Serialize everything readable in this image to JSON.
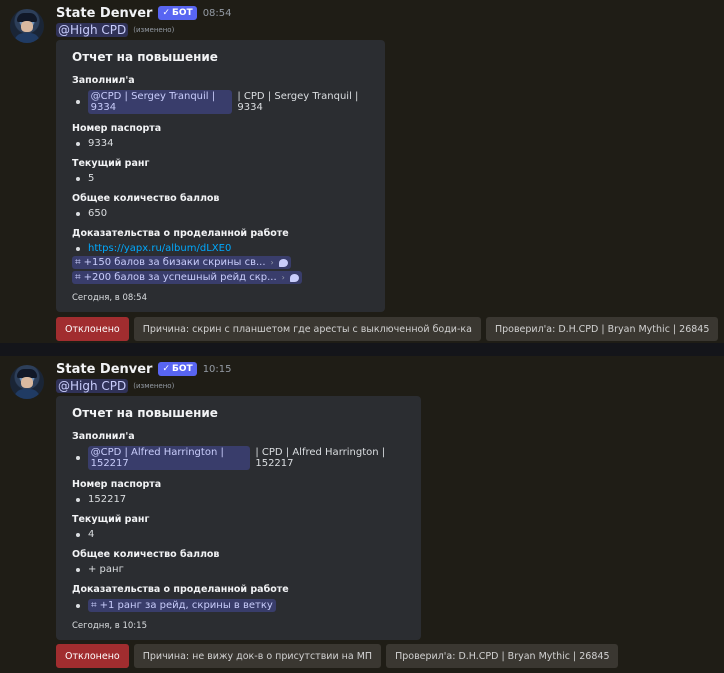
{
  "messages": [
    {
      "author": "State Denver",
      "bot_badge": "БОТ",
      "time": "08:54",
      "mention": "@High CPD",
      "edited": "(изменено)",
      "embed": {
        "title": "Отчет на повышение",
        "fields": {
          "filled_by": {
            "name": "Заполнил'а",
            "mention": "@CPD | Sergey Tranquil | 9334",
            "text": "| CPD | Sergey Tranquil | 9334"
          },
          "passport": {
            "name": "Номер паспорта",
            "value": "9334"
          },
          "rank": {
            "name": "Текущий ранг",
            "value": "5"
          },
          "points": {
            "name": "Общее количество баллов",
            "value": "650"
          },
          "evidence": {
            "name": "Доказательства о проделанной работе",
            "link": "https://yapx.ru/album/dLXE0",
            "threads": [
              "+150 балов за бизаки скрины св...",
              "+200 балов за успешный рейд скр..."
            ]
          }
        },
        "footer": "Сегодня, в 08:54"
      },
      "buttons": {
        "status": "Отклонено",
        "reason": "Причина: скрин с планшетом где аресты с выключенной боди-ка",
        "checked": "Проверил'а: D.H.CPD | Bryan Mythic | 26845"
      }
    },
    {
      "author": "State Denver",
      "bot_badge": "БОТ",
      "time": "10:15",
      "mention": "@High CPD",
      "edited": "(изменено)",
      "embed": {
        "title": "Отчет на повышение",
        "fields": {
          "filled_by": {
            "name": "Заполнил'а",
            "mention": "@CPD | Alfred Harrington | 152217",
            "text": "| CPD | Alfred Harrington | 152217"
          },
          "passport": {
            "name": "Номер паспорта",
            "value": "152217"
          },
          "rank": {
            "name": "Текущий ранг",
            "value": "4"
          },
          "points": {
            "name": "Общее количество баллов",
            "value": "+ ранг"
          },
          "evidence": {
            "name": "Доказательства о проделанной работе",
            "threads": [
              "+1 ранг за рейд, скрины в ветку"
            ]
          }
        },
        "footer": "Сегодня, в 10:15"
      },
      "buttons": {
        "status": "Отклонено",
        "reason": "Причина: не вижу док-в о присутствии на МП",
        "checked": "Проверил'а: D.H.CPD | Bryan Mythic | 26845"
      }
    }
  ],
  "colors": {
    "background": "#1f1d16",
    "embed": "#2b2d31",
    "danger": "#a12d2f",
    "bot_badge": "#5865f2",
    "link": "#00a8fc"
  },
  "icons": {
    "bot_check": "checkmark-icon",
    "thread": "thread-icon",
    "chevron": "chevron-right-icon",
    "bubble": "speech-bubble-icon"
  }
}
